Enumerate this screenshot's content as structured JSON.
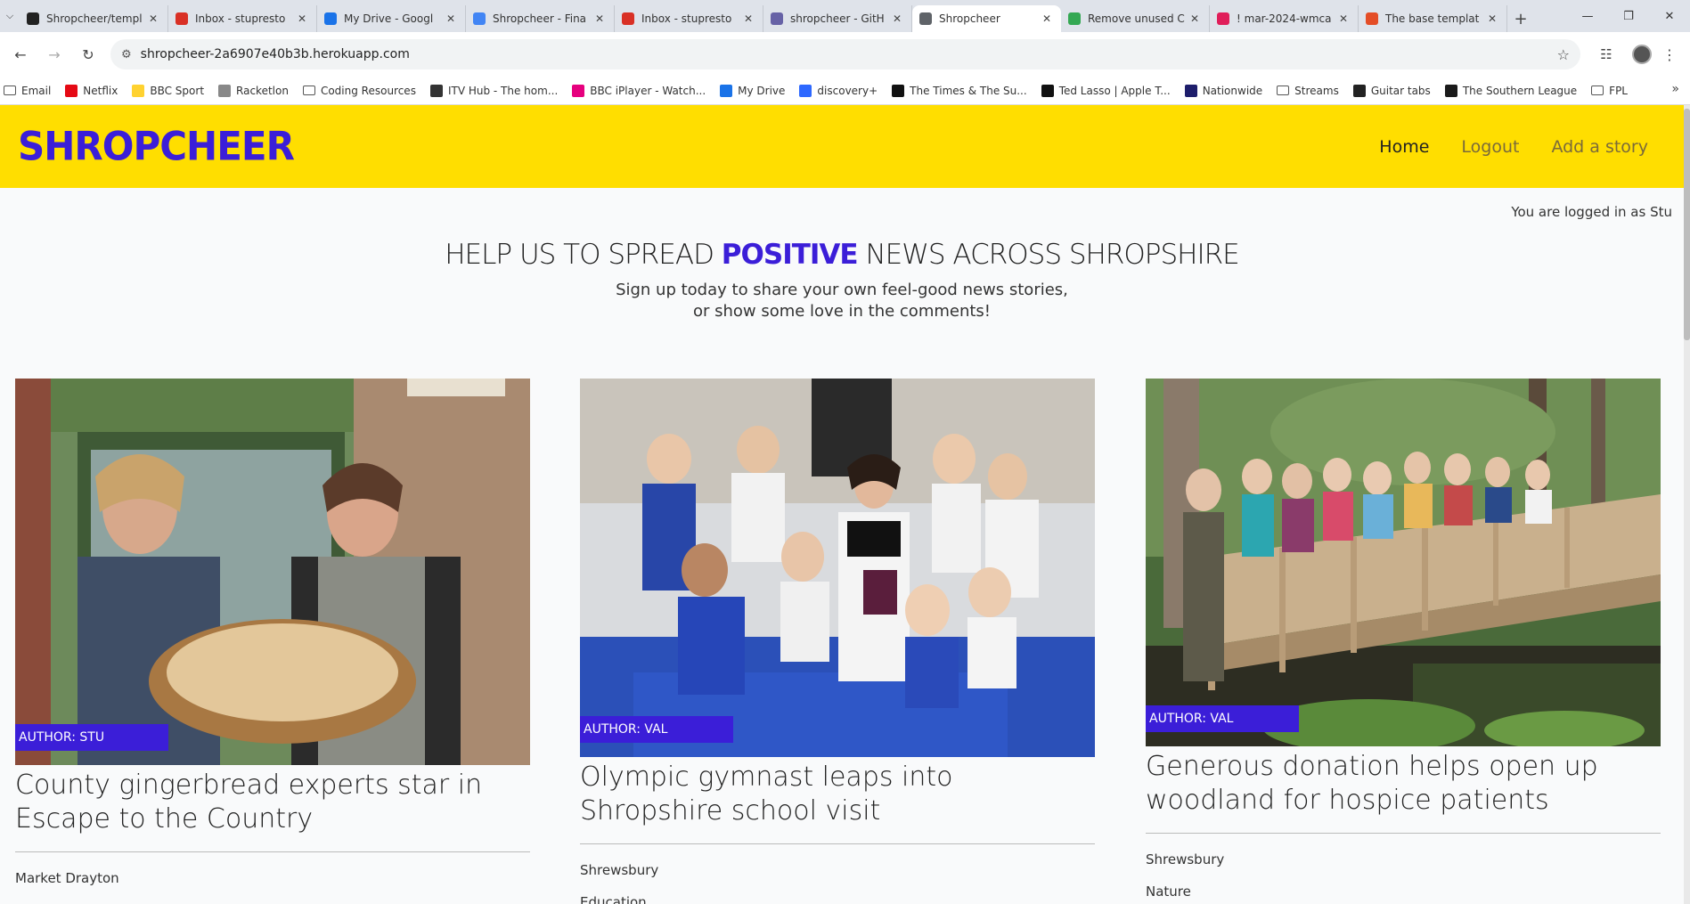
{
  "browser": {
    "tabs": [
      {
        "title": "Shropcheer/templ",
        "icon": "github-icon",
        "color": "#222222"
      },
      {
        "title": "Inbox - stupresto",
        "icon": "gmail-icon",
        "color": "#d93025"
      },
      {
        "title": "My Drive - Googl",
        "icon": "drive-icon",
        "color": "#1a73e8"
      },
      {
        "title": "Shropcheer - Fina",
        "icon": "docs-icon",
        "color": "#4285f4"
      },
      {
        "title": "Inbox - stupresto",
        "icon": "gmail-icon",
        "color": "#d93025"
      },
      {
        "title": "shropcheer - GitH",
        "icon": "heroku-icon",
        "color": "#6762a6"
      },
      {
        "title": "Shropcheer",
        "icon": "globe-icon",
        "color": "#5f6368",
        "active": true
      },
      {
        "title": "Remove unused C",
        "icon": "chrome-icon",
        "color": "#34a853"
      },
      {
        "title": "! mar-2024-wmca",
        "icon": "slack-icon",
        "color": "#e01e5a"
      },
      {
        "title": "The base templat",
        "icon": "opera-icon",
        "color": "#e44d26"
      }
    ],
    "url": "shropcheer-2a6907e40b3b.herokuapp.com",
    "bookmarks": [
      {
        "label": "Email",
        "icon": "folder-icon"
      },
      {
        "label": "Netflix",
        "icon": "netflix-icon",
        "color": "#e50914"
      },
      {
        "label": "BBC Sport",
        "icon": "bbc-sport-icon",
        "color": "#ffd230"
      },
      {
        "label": "Racketlon",
        "icon": "racketlon-icon",
        "color": "#888888"
      },
      {
        "label": "Coding Resources",
        "icon": "folder-icon"
      },
      {
        "label": "ITV Hub - The hom...",
        "icon": "itv-icon",
        "color": "#333333"
      },
      {
        "label": "BBC iPlayer - Watch...",
        "icon": "iplayer-icon",
        "color": "#e6007e"
      },
      {
        "label": "My Drive",
        "icon": "drive-icon",
        "color": "#1a73e8"
      },
      {
        "label": "discovery+",
        "icon": "discovery-icon",
        "color": "#2d68ff"
      },
      {
        "label": "The Times & The Su...",
        "icon": "times-icon",
        "color": "#111111"
      },
      {
        "label": "Ted Lasso | Apple T...",
        "icon": "appletv-icon",
        "color": "#111111"
      },
      {
        "label": "Nationwide",
        "icon": "nationwide-icon",
        "color": "#1d1d6b"
      },
      {
        "label": "Streams",
        "icon": "folder-icon"
      },
      {
        "label": "Guitar tabs",
        "icon": "guitar-icon",
        "color": "#222222"
      },
      {
        "label": "The Southern League",
        "icon": "league-icon",
        "color": "#1a1a1a"
      },
      {
        "label": "FPL",
        "icon": "folder-icon"
      }
    ]
  },
  "site": {
    "brand": "SHROPCHEER",
    "nav": [
      {
        "label": "Home",
        "active": true
      },
      {
        "label": "Logout"
      },
      {
        "label": "Add a story"
      }
    ],
    "login_status": "You are logged in as Stu",
    "hero": {
      "title_before": "HELP US TO SPREAD ",
      "title_highlight": "POSITIVE",
      "title_after": " NEWS ACROSS SHROPSHIRE",
      "subtitle_line1": "Sign up today to share your own feel-good news stories,",
      "subtitle_line2": "or show some love in the comments!"
    },
    "accent_color": "#3b1ed8",
    "navbar_color": "#ffde00",
    "stories": [
      {
        "author": "AUTHOR: STU",
        "title": "County gingerbread experts star in Escape to the Country",
        "location": "Market Drayton",
        "category": "",
        "image": "gingerbread-shop-photo"
      },
      {
        "author": "AUTHOR: VAL",
        "title": "Olympic gymnast leaps into Shropshire school visit",
        "location": "Shrewsbury",
        "category": "Education",
        "image": "school-children-photo"
      },
      {
        "author": "AUTHOR: VAL",
        "title": "Generous donation helps open up woodland for hospice patients",
        "location": "Shrewsbury",
        "category": "Nature",
        "image": "woodland-bridge-photo"
      }
    ]
  }
}
